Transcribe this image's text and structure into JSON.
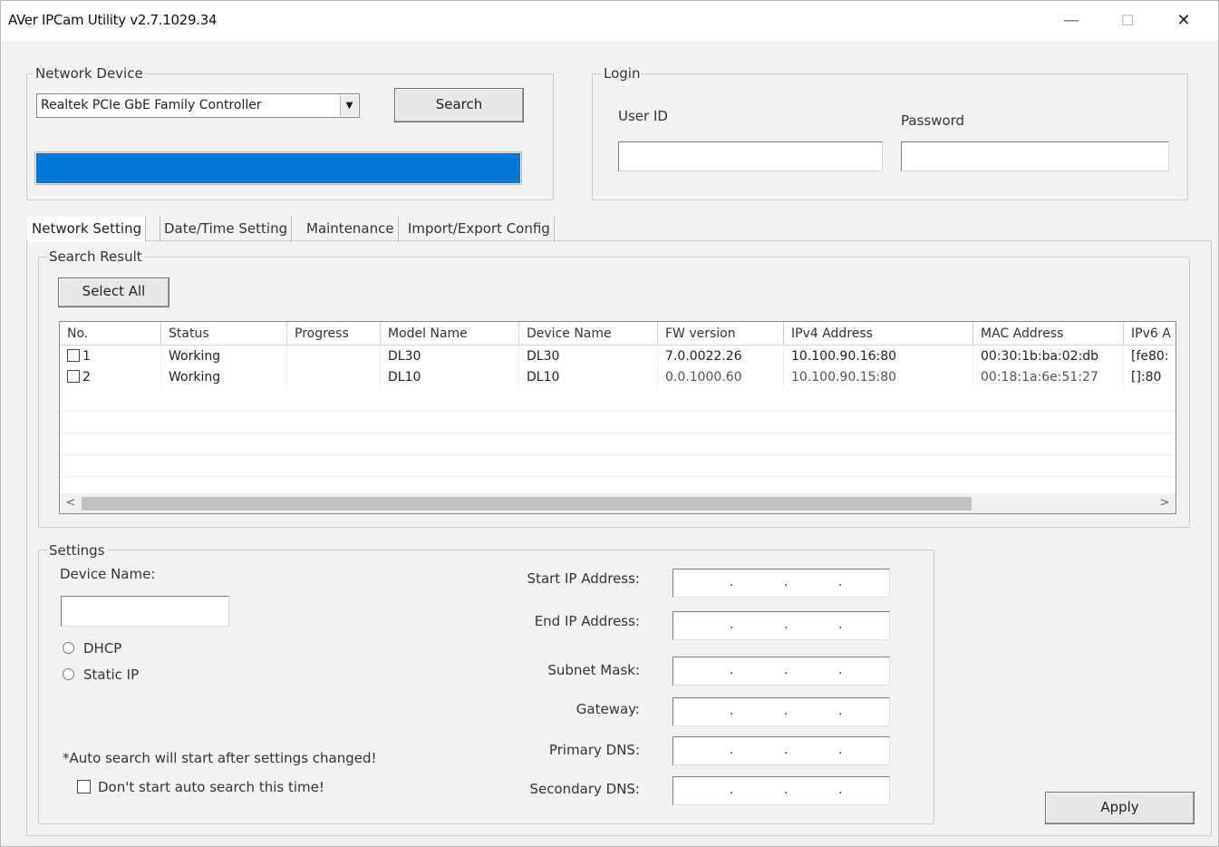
{
  "window": {
    "title": "AVer IPCam Utility v2.7.1029.34",
    "minimize": "—",
    "maximize": "☐",
    "close": "✕"
  },
  "network_device": {
    "legend": "Network Device",
    "selected_adapter": "Realtek PCIe GbE Family Controller",
    "search_label": "Search",
    "progress_fraction": 1.0
  },
  "login": {
    "legend": "Login",
    "user_id_label": "User ID",
    "password_label": "Password",
    "user_id_value": "",
    "password_value": ""
  },
  "tabs": [
    {
      "label": "Network Setting",
      "active": true
    },
    {
      "label": "Date/Time Setting",
      "active": false
    },
    {
      "label": "Maintenance",
      "active": false
    },
    {
      "label": "Import/Export Config",
      "active": false
    }
  ],
  "search_result": {
    "legend": "Search Result",
    "select_all_label": "Select All",
    "columns": [
      "No.",
      "Status",
      "Progress",
      "Model Name",
      "Device Name",
      "FW version",
      "IPv4 Address",
      "MAC Address",
      "IPv6 A"
    ],
    "rows": [
      {
        "no": "1",
        "status": "Working",
        "progress": "",
        "model": "DL30",
        "device": "DL30",
        "fw": "7.0.0022.26",
        "ipv4": "10.100.90.16:80",
        "mac": "00:30:1b:ba:02:db",
        "ipv6": "[fe80:"
      },
      {
        "no": "2",
        "status": "Working",
        "progress": "",
        "model": "DL10",
        "device": "DL10",
        "fw": "0.0.1000.60",
        "ipv4": "10.100.90.15:80",
        "mac": "00:18:1a:6e:51:27",
        "ipv6": "[]:80"
      }
    ],
    "scroll_left": "<",
    "scroll_right": ">"
  },
  "settings": {
    "legend": "Settings",
    "device_name_label": "Device Name:",
    "device_name_value": "",
    "dhcp_label": "DHCP",
    "static_ip_label": "Static IP",
    "auto_search_note": "*Auto search will start after settings changed!",
    "dont_auto_search_label": "Don't start auto search this time!",
    "ip_fields": [
      {
        "label": "Start IP Address:"
      },
      {
        "label": "End IP Address:"
      },
      {
        "label": "Subnet Mask:"
      },
      {
        "label": "Gateway:"
      },
      {
        "label": "Primary DNS:"
      },
      {
        "label": "Secondary DNS:"
      }
    ],
    "ip_separator": ".",
    "apply_label": "Apply"
  },
  "colors": {
    "progress": "#0078d7",
    "window_bg": "#f2f2f2"
  }
}
